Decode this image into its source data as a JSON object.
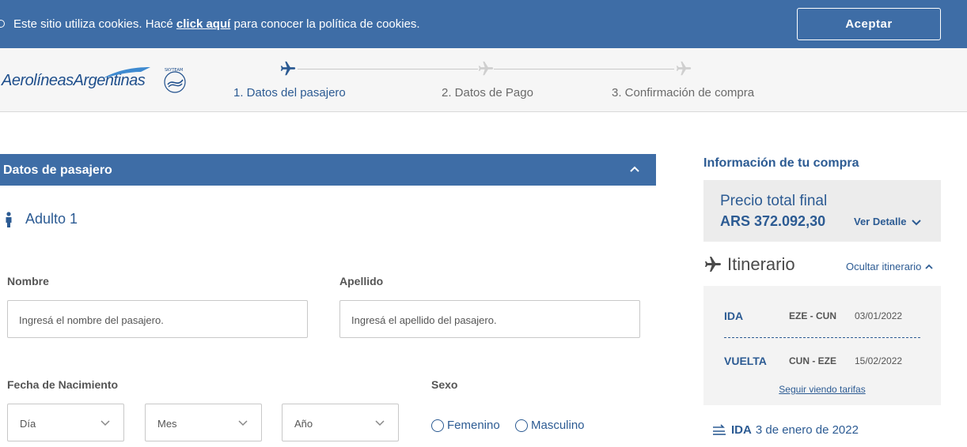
{
  "cookie": {
    "text_before": "Este sitio utiliza cookies. Hacé ",
    "link": "click aquí",
    "text_after": " para conocer la política de cookies.",
    "accept_label": "Aceptar"
  },
  "brand": {
    "logo_text": "AerolíneasArgentinas",
    "partner": "SKYTEAM"
  },
  "steps": [
    {
      "label": "1. Datos del pasajero",
      "active": true
    },
    {
      "label": "2. Datos de Pago",
      "active": false
    },
    {
      "label": "3. Confirmación de compra",
      "active": false
    }
  ],
  "passenger": {
    "section_title": "Datos de pasajero",
    "adult_label": "Adulto 1",
    "nombre_label": "Nombre",
    "nombre_placeholder": "Ingresá el nombre del pasajero.",
    "apellido_label": "Apellido",
    "apellido_placeholder": "Ingresá el apellido del pasajero.",
    "birth_label": "Fecha de Nacimiento",
    "day": "Día",
    "month": "Mes",
    "year": "Año",
    "sex_label": "Sexo",
    "female": "Femenino",
    "male": "Masculino"
  },
  "summary": {
    "title": "Información de tu compra",
    "price_label": "Precio total final",
    "price_value": "ARS 372.092,30",
    "detail_link": "Ver Detalle",
    "itinerary_title": "Itinerario",
    "hide_link": "Ocultar itinerario",
    "legs": [
      {
        "type": "IDA",
        "route": "EZE - CUN",
        "date": "03/01/2022"
      },
      {
        "type": "VUELTA",
        "route": "CUN - EZE",
        "date": "15/02/2022"
      }
    ],
    "more_link": "Seguir viendo tarifas",
    "ida_tag": "IDA",
    "ida_date": "3 de enero de 2022"
  },
  "colors": {
    "brand_blue": "#3e6da6",
    "text_blue": "#2c5b93"
  }
}
